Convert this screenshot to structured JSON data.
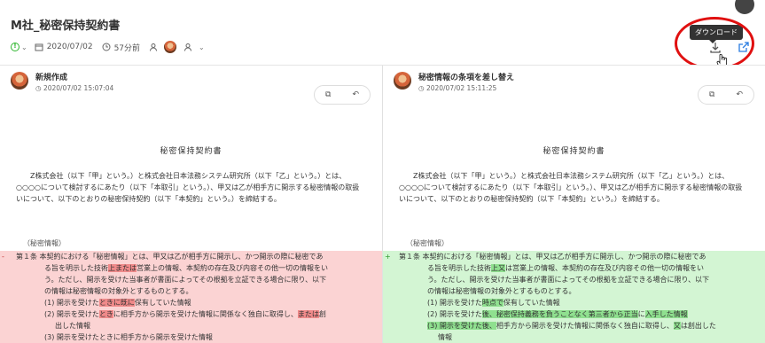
{
  "header": {
    "title": "M社_秘密保持契約書",
    "date": "2020/07/02",
    "elapsed": "57分前"
  },
  "toolbar": {
    "tooltip": "ダウンロード"
  },
  "left": {
    "version_title": "新規作成",
    "version_date": "2020/07/02 15:07:04",
    "heading": "秘密保持契約書",
    "para": "Z株式会社（以下「甲」という。）と株式会社日本法務システム研究所（以下「乙」という。）とは、○○○○について検討するにあたり（以下「本取引」という。）、甲又は乙が相手方に開示する秘密情報の取扱いについて、以下のとおりの秘密保持契約（以下「本契約」という。）を締結する。",
    "section_label": "（秘密情報）",
    "diff_marker": "-",
    "lines": {
      "l1": "第１条 本契約における「秘密情報」とは、甲又は乙が相手方に開示し、かつ開示の際に秘密であ",
      "l2a": "る旨を明示した技術",
      "l2b": "上または",
      "l2c": "営業上の情報、本契約の存在及び内容その他一切の情報をい",
      "l3": "う。ただし、開示を受けた当事者が書面によってその根拠を立証できる場合に限り、以下",
      "l4": "の情報は秘密情報の対象外とするものとする。",
      "l5a": "(1) 開示を受けた",
      "l5b": "ときに既に",
      "l5c": "保有していた情報",
      "l6a": "(2) 開示を受けた",
      "l6b": "とき",
      "l6c": "に相手方から開示を受けた情報に関係なく独自に取得し、",
      "l6d": "または",
      "l6e": "創",
      "l7": "出した情報",
      "l8": "(3) 開示を受けたときに相手方から開示を受けた情報"
    }
  },
  "right": {
    "version_title": "秘密情報の条項を差し替え",
    "version_date": "2020/07/02 15:11:25",
    "heading": "秘密保持契約書",
    "para": "Z株式会社（以下「甲」という。）と株式会社日本法務システム研究所（以下「乙」という。）とは、○○○○について検討するにあたり（以下「本取引」という。）、甲又は乙が相手方に開示する秘密情報の取扱いについて、以下のとおりの秘密保持契約（以下「本契約」という。）を締結する。",
    "section_label": "（秘密情報）",
    "diff_marker": "+",
    "lines": {
      "l1": "第１条 本契約における「秘密情報」とは、甲又は乙が相手方に開示し、かつ開示の際に秘密であ",
      "l2a": "る旨を明示した技術",
      "l2b": "上又",
      "l2c": "は営業上の情報、本契約の存在及び内容その他一切の情報をい",
      "l3": "う。ただし、開示を受けた当事者が書面によってその根拠を立証できる場合に限り、以下",
      "l4": "の情報は秘密情報の対象外とするものとする。",
      "l5a": "(1) 開示を受けた",
      "l5b": "時点で",
      "l5c": "保有していた情報",
      "l6a": "(2) 開示を受けた",
      "l6b": "後、秘密保持義務を負うことなく第三者から正当",
      "l6c": "に",
      "l6d": "入手した情報",
      "l7a": "(3) 開示を受けた",
      "l7b": "後、",
      "l7c": "相手方から開示を受けた情報に関係なく独自に取得し、",
      "l7d": "又",
      "l7e": "は創出した",
      "l8": "情報"
    }
  }
}
